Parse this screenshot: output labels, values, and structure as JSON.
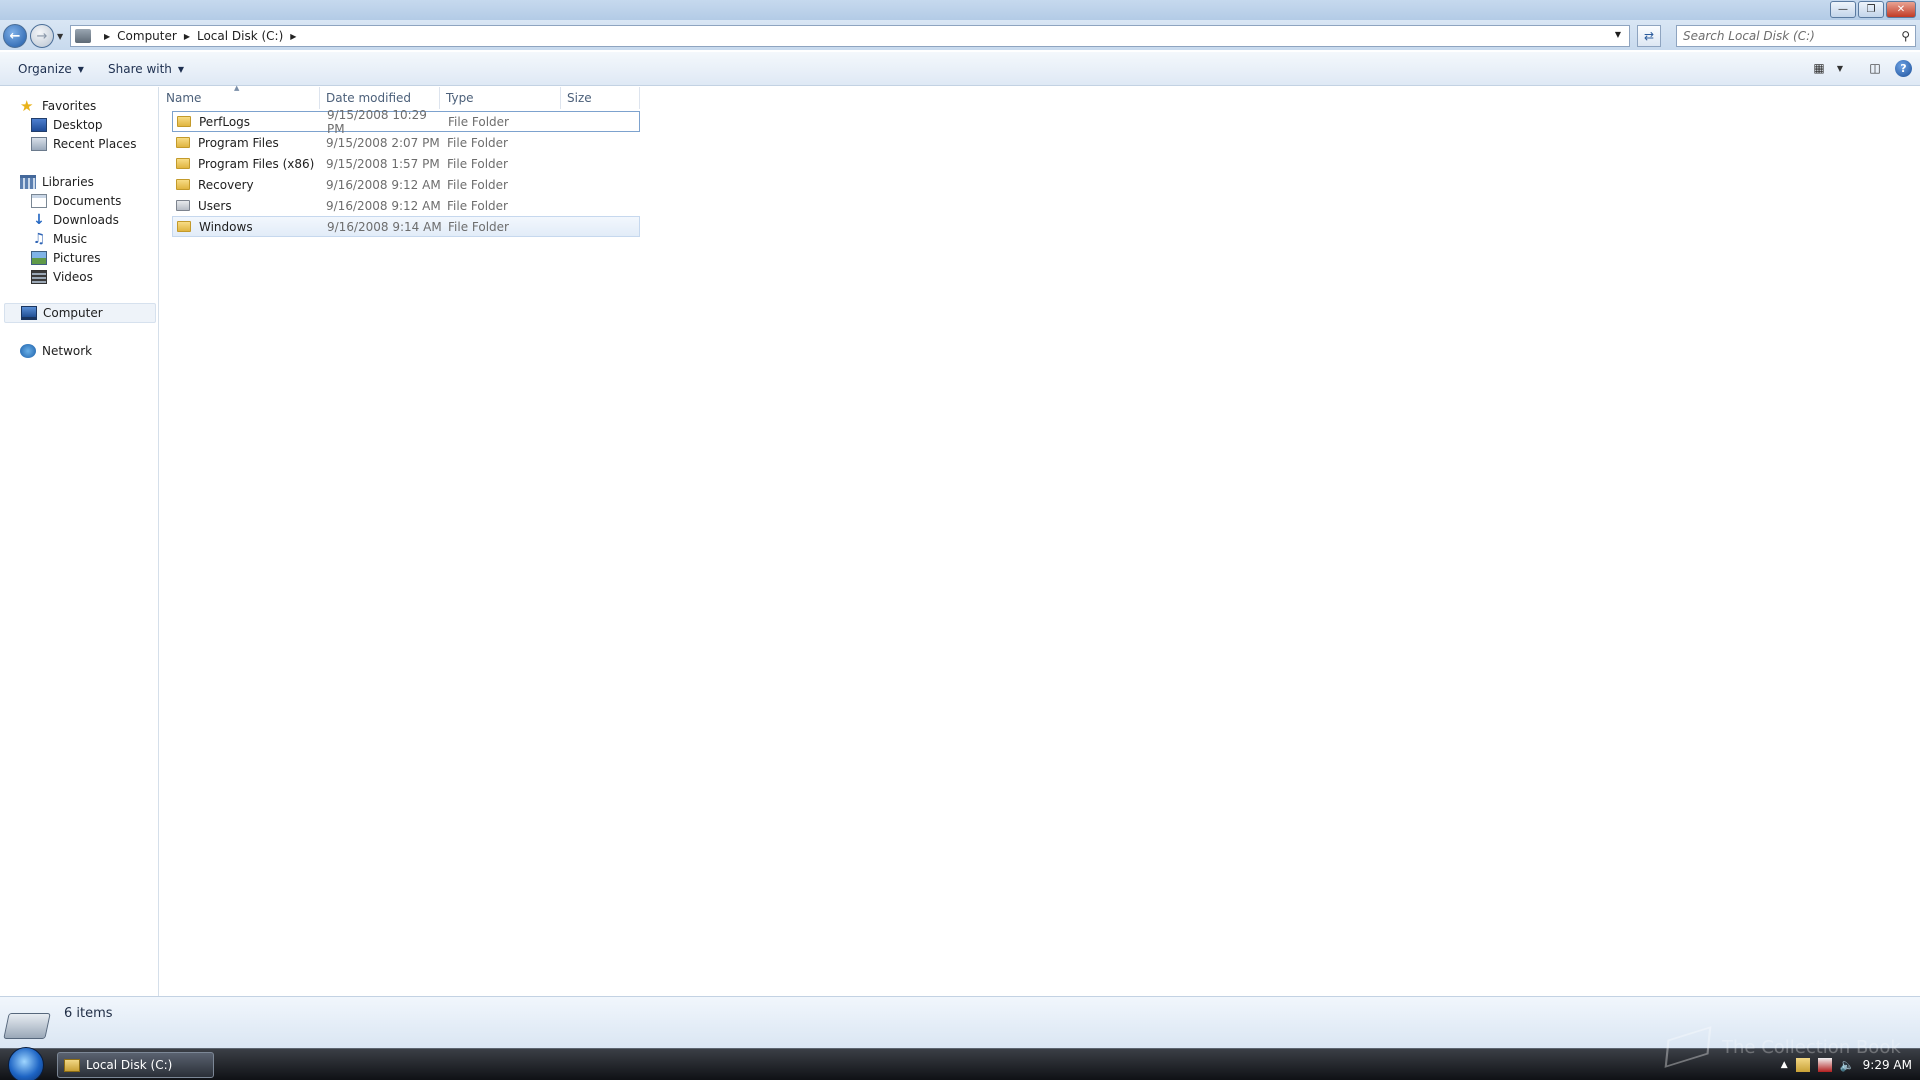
{
  "window": {
    "minimize_icon": "minimize-icon",
    "maximize_icon": "restore-icon",
    "close_icon": "close-icon"
  },
  "address": {
    "crumbs": [
      "Computer",
      "Local Disk (C:)"
    ],
    "search_placeholder": "Search Local Disk (C:)"
  },
  "toolbar": {
    "organize": "Organize",
    "share_with": "Share with"
  },
  "sidebar": {
    "favorites": {
      "label": "Favorites",
      "items": [
        {
          "label": "Desktop"
        },
        {
          "label": "Recent Places"
        }
      ]
    },
    "libraries": {
      "label": "Libraries",
      "items": [
        {
          "label": "Documents"
        },
        {
          "label": "Downloads"
        },
        {
          "label": "Music"
        },
        {
          "label": "Pictures"
        },
        {
          "label": "Videos"
        }
      ]
    },
    "computer": "Computer",
    "network": "Network"
  },
  "columns": {
    "name": "Name",
    "date": "Date modified",
    "type": "Type",
    "size": "Size"
  },
  "files": [
    {
      "name": "PerfLogs",
      "date": "9/15/2008 10:29 PM",
      "type": "File Folder"
    },
    {
      "name": "Program Files",
      "date": "9/15/2008 2:07 PM",
      "type": "File Folder"
    },
    {
      "name": "Program Files (x86)",
      "date": "9/15/2008 1:57 PM",
      "type": "File Folder"
    },
    {
      "name": "Recovery",
      "date": "9/16/2008 9:12 AM",
      "type": "File Folder"
    },
    {
      "name": "Users",
      "date": "9/16/2008 9:12 AM",
      "type": "File Folder"
    },
    {
      "name": "Windows",
      "date": "9/16/2008 9:14 AM",
      "type": "File Folder"
    }
  ],
  "status": {
    "item_count": "6 items"
  },
  "taskbar": {
    "task_label": "Local Disk (C:)",
    "clock": "9:29 AM",
    "watermark": "The Collection Book"
  }
}
